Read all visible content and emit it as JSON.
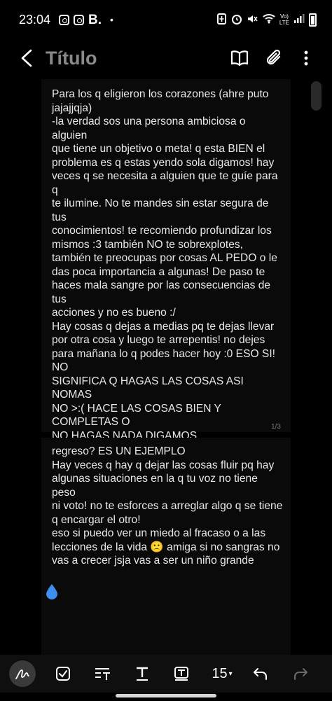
{
  "status_bar": {
    "time": "23:04",
    "b_label": "B.",
    "dot": "•",
    "net_label_1": "Vo)",
    "net_label_2": "LTE"
  },
  "app_bar": {
    "title": "Título"
  },
  "page1": {
    "text": "Para los q eligieron los corazones (ahre puto\njajajjqja)\n-la verdad sos una persona ambiciosa o alguien\nque tiene un objetivo o meta! q esta BIEN el\nproblema es q estas yendo sola digamos! hay\nveces q se necesita a alguien que te guíe para q\nte ilumine. No te mandes sin estar segura de tus\nconocimientos! te recomiendo profundizar los\nmismos :3 también NO te sobrexplotes,\ntambién te preocupas por cosas AL PEDO o le\ndas poca importancia a algunas! De paso te\nhaces mala sangre por las consecuencias de tus\nacciones y no es bueno :/\nHay cosas q dejas a medias pq te dejas llevar\npor otra cosa y luego te arrepentis! no dejes\npara mañana lo q podes hacer hoy :0 ESO SI! NO\nSIGNIFICA Q HAGAS LAS COSAS ASI NOMAS\nNO >:( HACE LAS COSAS BIEN Y COMPLETAS O\nNO HAGAS NADA DIGAMOS\nHay cosas q anhelas q están buenas pero te\nrecomiendo quedarte con las que te van a\nproducir un beneficio! no con las q te van a\nhacer sentir mal! por ejemplo si vos sabes q\ncierta persona te lastimo ¿pq queres su",
    "page_number": "1/3"
  },
  "page2": {
    "text": "regreso? ES UN EJEMPLO\nHay veces q hay q dejar las cosas fluir pq hay\nalgunas situaciones en la q tu voz no tiene peso\nni voto! no te esforces a arreglar algo q se tiene\nq encargar el otro!\neso si puedo ver un miedo al fracaso o a las\nlecciones de la vida 🙁 amiga si no sangras no\nvas a crecer jsja vas a ser un niño grande"
  },
  "toolbar": {
    "font_size": "15",
    "caret": "▾"
  },
  "colors": {
    "background": "#000000",
    "page": "#0a0a0a",
    "text": "#e9e9e9",
    "title": "#8a8a8a",
    "drop_accent": "#3d8ff0"
  },
  "icons": {
    "status_left": [
      "instagram-icon",
      "instagram-icon"
    ],
    "status_right": [
      "battery-saver-icon",
      "alarm-icon",
      "mute-icon",
      "wifi-icon",
      "signal-icon",
      "battery-icon"
    ],
    "app_bar": [
      "back-icon",
      "book-icon",
      "paperclip-icon",
      "more-vert-icon"
    ],
    "toolbar": [
      "pen-icon",
      "checkbox-icon",
      "text-format-icon",
      "text-style-icon",
      "text-box-icon",
      "font-size-dropdown",
      "undo-icon",
      "redo-icon"
    ]
  }
}
